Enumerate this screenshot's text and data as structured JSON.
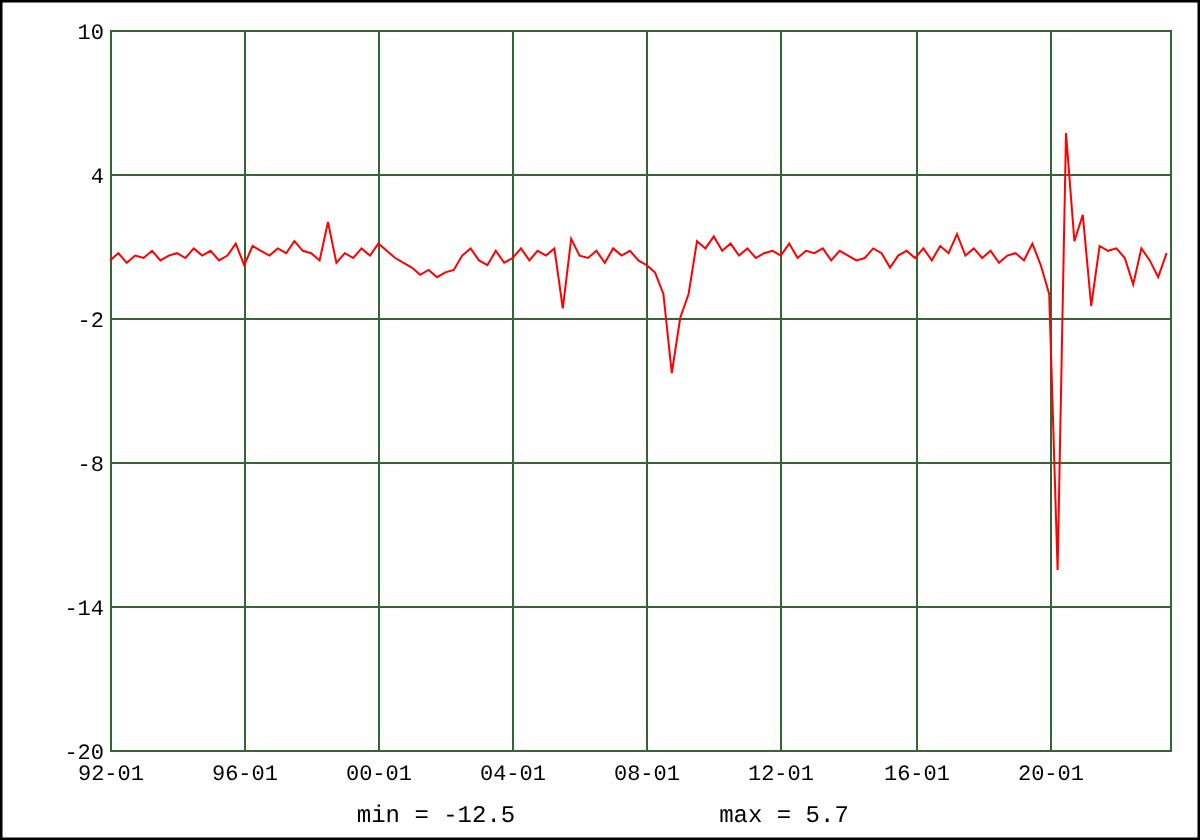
{
  "chart": {
    "chart_data": {
      "type": "line",
      "categories": [
        "92-01",
        null,
        null,
        null,
        null,
        null,
        null,
        null,
        null,
        null,
        null,
        null,
        null,
        null,
        null,
        null,
        "96-01",
        null,
        null,
        null,
        null,
        null,
        null,
        null,
        null,
        null,
        null,
        null,
        null,
        null,
        null,
        null,
        "00-01",
        null,
        null,
        null,
        null,
        null,
        null,
        null,
        null,
        null,
        null,
        null,
        null,
        null,
        null,
        null,
        "04-01",
        null,
        null,
        null,
        null,
        null,
        null,
        null,
        null,
        null,
        null,
        null,
        null,
        null,
        null,
        null,
        "08-01",
        null,
        null,
        null,
        null,
        null,
        null,
        null,
        null,
        null,
        null,
        null,
        null,
        null,
        null,
        null,
        "12-01",
        null,
        null,
        null,
        null,
        null,
        null,
        null,
        null,
        null,
        null,
        null,
        null,
        null,
        null,
        null,
        "16-01",
        null,
        null,
        null,
        null,
        null,
        null,
        null,
        null,
        null,
        null,
        null,
        null,
        null,
        null,
        null,
        "20-01",
        null,
        null,
        null,
        null,
        null,
        null,
        null,
        null,
        null,
        null,
        null,
        null,
        null,
        null
      ],
      "series": [
        {
          "color": "#ff0000",
          "values": [
            0.4,
            0.7,
            0.3,
            0.6,
            0.5,
            0.8,
            0.4,
            0.6,
            0.7,
            0.5,
            0.9,
            0.6,
            0.8,
            0.4,
            0.6,
            1.1,
            0.2,
            1.0,
            0.8,
            0.6,
            0.9,
            0.7,
            1.2,
            0.8,
            0.7,
            0.4,
            2.0,
            0.3,
            0.7,
            0.5,
            0.9,
            0.6,
            1.1,
            0.8,
            0.5,
            0.3,
            0.1,
            -0.2,
            0.0,
            -0.3,
            -0.1,
            0.0,
            0.6,
            0.9,
            0.4,
            0.2,
            0.8,
            0.3,
            0.5,
            0.9,
            0.4,
            0.8,
            0.6,
            0.9,
            -1.6,
            1.3,
            0.6,
            0.5,
            0.8,
            0.3,
            0.9,
            0.6,
            0.8,
            0.4,
            0.2,
            -0.1,
            -1.0,
            -4.3,
            -2.0,
            -1.0,
            1.2,
            0.9,
            1.4,
            0.8,
            1.1,
            0.6,
            0.9,
            0.5,
            0.7,
            0.8,
            0.6,
            1.1,
            0.5,
            0.8,
            0.7,
            0.9,
            0.4,
            0.8,
            0.6,
            0.4,
            0.5,
            0.9,
            0.7,
            0.1,
            0.6,
            0.8,
            0.5,
            0.9,
            0.4,
            1.0,
            0.7,
            1.5,
            0.6,
            0.9,
            0.5,
            0.8,
            0.3,
            0.6,
            0.7,
            0.4,
            1.1,
            0.2,
            -1.0,
            -12.5,
            5.7,
            1.2,
            2.3,
            -1.5,
            1.0,
            0.8,
            0.9,
            0.5,
            -0.6,
            0.9,
            0.4,
            -0.3,
            0.7
          ]
        }
      ],
      "grid": true,
      "ylim": [
        -20,
        10
      ],
      "yticks": [
        10,
        4,
        -2,
        -8,
        -14,
        -20
      ]
    }
  },
  "summary": [
    {
      "text": "min = -12.5"
    },
    {
      "text": "max = 5.7"
    }
  ]
}
